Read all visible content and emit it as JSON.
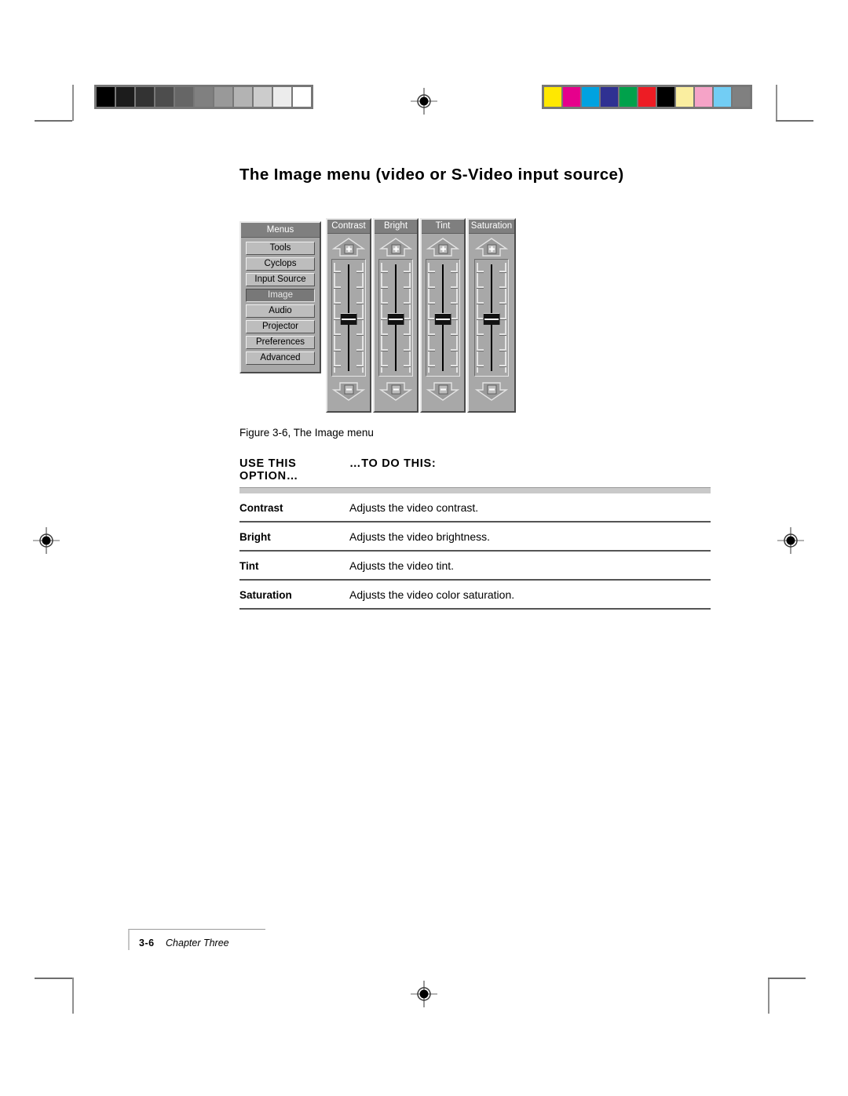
{
  "page": {
    "title": "The Image menu (video or S-Video input source)",
    "figure_caption": "Figure 3-6, The Image menu",
    "footer_page": "3-6",
    "footer_chapter": "Chapter Three"
  },
  "osd": {
    "menus": {
      "title": "Menus",
      "items": [
        {
          "label": "Tools",
          "selected": false
        },
        {
          "label": "Cyclops",
          "selected": false
        },
        {
          "label": "Input Source",
          "selected": false
        },
        {
          "label": "Image",
          "selected": true
        },
        {
          "label": "Audio",
          "selected": false
        },
        {
          "label": "Projector",
          "selected": false
        },
        {
          "label": "Preferences",
          "selected": false
        },
        {
          "label": "Advanced",
          "selected": false
        }
      ]
    },
    "sliders": [
      {
        "title": "Contrast",
        "increase_symbol": "+",
        "decrease_symbol": "–",
        "value_percent": 52
      },
      {
        "title": "Bright",
        "increase_symbol": "+",
        "decrease_symbol": "–",
        "value_percent": 52
      },
      {
        "title": "Tint",
        "increase_symbol": "+",
        "decrease_symbol": "–",
        "value_percent": 52
      },
      {
        "title": "Saturation",
        "increase_symbol": "+",
        "decrease_symbol": "–",
        "value_percent": 52
      }
    ]
  },
  "table": {
    "header": {
      "col1": "USE THIS OPTION…",
      "col1_line1": "USE THIS",
      "col1_line2": "OPTION…",
      "col2": "…TO DO THIS:"
    },
    "rows": [
      {
        "option": "Contrast",
        "description": "Adjusts the video contrast."
      },
      {
        "option": "Bright",
        "description": "Adjusts the video brightness."
      },
      {
        "option": "Tint",
        "description": "Adjusts the video tint."
      },
      {
        "option": "Saturation",
        "description": "Adjusts the video color saturation."
      }
    ]
  },
  "calibration": {
    "grayscale_label": "grayscale-calibration-strip",
    "grayscale_swatches": [
      "#000000",
      "#1c1c1c",
      "#333333",
      "#4d4d4d",
      "#666666",
      "#808080",
      "#999999",
      "#b3b3b3",
      "#cccccc",
      "#ececec",
      "#ffffff"
    ],
    "color_label": "color-calibration-strip",
    "color_swatches": [
      "#ffe800",
      "#e6008c",
      "#00a2e0",
      "#2f3192",
      "#00a14b",
      "#ed1c24",
      "#000000",
      "#faeea0",
      "#f5a3c7",
      "#72cdf4",
      "#808080"
    ]
  },
  "marks": {
    "registration_label": "registration-target"
  }
}
